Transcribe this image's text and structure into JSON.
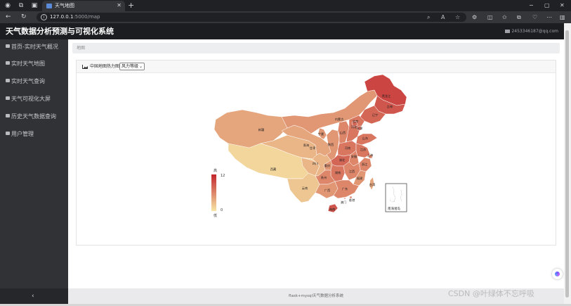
{
  "browser": {
    "tab_title": "天气地图",
    "url_host": "127.0.0.1",
    "url_path": ":5000/map",
    "icons": [
      "profile-icon",
      "workspaces-icon",
      "tab-actions-icon",
      "back-icon",
      "refresh-icon",
      "site-info-icon",
      "zoom-icon",
      "read-aloud-icon",
      "favorite-icon",
      "extensions-icon",
      "split-screen-icon",
      "favorites-bar-icon",
      "collections-icon",
      "browser-essentials-icon",
      "sidebar-toggle-icon"
    ],
    "minimize": "−",
    "maximize": "▢",
    "close": "✕",
    "new_tab": "+"
  },
  "app": {
    "title": "天气数据分析预测与可视化系统",
    "user_email": "2453346187@qq.com"
  },
  "sidebar": {
    "items": [
      {
        "label": "首页-实时天气概况",
        "icon": "home-icon"
      },
      {
        "label": "实时天气地图",
        "icon": "map-icon"
      },
      {
        "label": "实时天气查询",
        "icon": "monitor-icon"
      },
      {
        "label": "天气可视化大屏",
        "icon": "display-icon"
      },
      {
        "label": "历史天气数据查询",
        "icon": "list-icon"
      },
      {
        "label": "用户管理",
        "icon": "users-icon"
      }
    ],
    "collapse_label": "‹"
  },
  "breadcrumb": "地图",
  "panel": {
    "label": "中国地图热力图:",
    "selected_metric": "风力等级"
  },
  "visual_map": {
    "high_label": "高",
    "low_label": "低",
    "max": 12,
    "min": 0,
    "colors": [
      "#f7e6a6",
      "#c2262e"
    ]
  },
  "map_data": {
    "provinces": [
      {
        "name": "黑龙江",
        "value": 10
      },
      {
        "name": "吉林",
        "value": 9
      },
      {
        "name": "辽宁",
        "value": 8
      },
      {
        "name": "内蒙古",
        "value": 5
      },
      {
        "name": "新疆",
        "value": 4
      },
      {
        "name": "西藏",
        "value": 1
      },
      {
        "name": "青海",
        "value": 3
      },
      {
        "name": "甘肃",
        "value": 4
      },
      {
        "name": "宁夏",
        "value": 5
      },
      {
        "name": "陕西",
        "value": 5
      },
      {
        "name": "山西",
        "value": 6
      },
      {
        "name": "河北",
        "value": 7
      },
      {
        "name": "北京",
        "value": 8
      },
      {
        "name": "天津",
        "value": 8
      },
      {
        "name": "山东",
        "value": 7
      },
      {
        "name": "河南",
        "value": 7
      },
      {
        "name": "四川",
        "value": 3
      },
      {
        "name": "重庆",
        "value": 5
      },
      {
        "name": "湖北",
        "value": 8
      },
      {
        "name": "安徽",
        "value": 6
      },
      {
        "name": "江苏",
        "value": 7
      },
      {
        "name": "上海",
        "value": 6
      },
      {
        "name": "浙江",
        "value": 6
      },
      {
        "name": "湖南",
        "value": 7
      },
      {
        "name": "江西",
        "value": 6
      },
      {
        "name": "福建",
        "value": 5
      },
      {
        "name": "贵州",
        "value": 6
      },
      {
        "name": "云南",
        "value": 2
      },
      {
        "name": "广西",
        "value": 5
      },
      {
        "name": "广东",
        "value": 6
      },
      {
        "name": "海南",
        "value": 9
      },
      {
        "name": "台湾",
        "value": 4
      },
      {
        "name": "香港",
        "value": 6
      },
      {
        "name": "澳门",
        "value": 6
      }
    ],
    "inset_label": "南海诸岛"
  },
  "footer": "flask+mysql天气数据分析系统",
  "watermark": "CSDN @叶绿体不忘呼吸"
}
